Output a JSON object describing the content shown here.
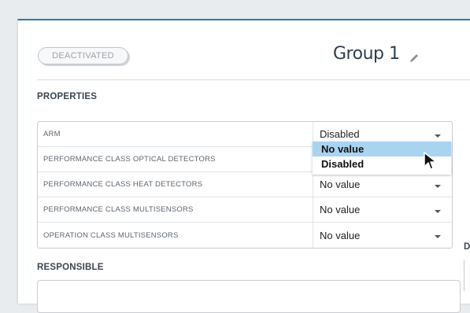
{
  "status_badge": "DEACTIVATED",
  "group_title": "Group 1",
  "sections": {
    "properties": "PROPERTIES",
    "responsible": "RESPONSIBLE",
    "right_truncated": "DI"
  },
  "properties": [
    {
      "label": "ARM",
      "value": "Disabled"
    },
    {
      "label": "PERFORMANCE CLASS OPTICAL DETECTORS",
      "value": ""
    },
    {
      "label": "PERFORMANCE CLASS HEAT DETECTORS",
      "value": "No value"
    },
    {
      "label": "PERFORMANCE CLASS MULTISENSORS",
      "value": "No value"
    },
    {
      "label": "OPERATION CLASS MULTISENSORS",
      "value": "No value"
    }
  ],
  "dropdown": {
    "options": [
      "No value",
      "Disabled"
    ],
    "highlighted_index": 0
  },
  "colors": {
    "accent": "#2a7ab0",
    "highlight": "#a9d4f0",
    "title": "#2c3e50"
  },
  "icons": [
    "pencil-icon",
    "chevron-down-icon",
    "mouse-cursor-icon"
  ]
}
